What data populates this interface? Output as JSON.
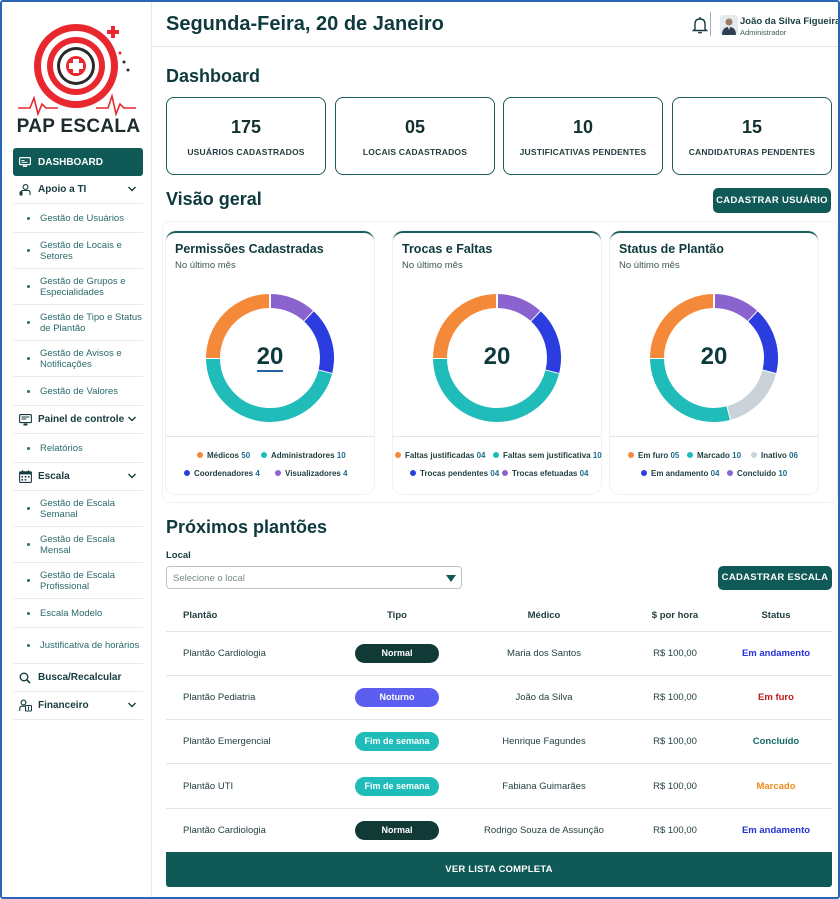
{
  "app": {
    "logo_text": "PAP ESCALA"
  },
  "header": {
    "date": "Segunda-Feira, 20 de Janeiro",
    "user_name": "João da Silva Figueira",
    "user_role": "Administrador"
  },
  "sidebar": {
    "items": [
      {
        "label": "DASHBOARD",
        "icon": "monitor-icon",
        "active": true
      },
      {
        "label": "Apoio a TI",
        "icon": "support-icon",
        "expandable": true,
        "children": [
          "Gestão de Usuários",
          "Gestão de Locais e Setores",
          "Gestão de Grupos e Especialidades",
          "Gestão de Tipo e Status de Plantão",
          "Gestão de Avisos e Notificações",
          "Gestão de Valores"
        ]
      },
      {
        "label": "Painel de controle",
        "icon": "control-panel-icon",
        "expandable": true,
        "children": [
          "Relatórios"
        ]
      },
      {
        "label": "Escala",
        "icon": "calendar-icon",
        "expandable": true,
        "children": [
          "Gestão de Escala Semanal",
          "Gestão de Escala Mensal",
          "Gestão de Escala Profissional",
          "Escala Modelo",
          "Justificativa de horários"
        ]
      },
      {
        "label": "Busca/Recalcular",
        "icon": "search-icon",
        "expandable": false
      },
      {
        "label": "Financeiro",
        "icon": "finance-icon",
        "expandable": true
      }
    ]
  },
  "dashboard": {
    "title": "Dashboard",
    "stats": [
      {
        "value": "175",
        "label": "USUÁRIOS CADASTRADOS"
      },
      {
        "value": "05",
        "label": "LOCAIS CADASTRADOS"
      },
      {
        "value": "10",
        "label": "JUSTIFICATIVAS PENDENTES"
      },
      {
        "value": "15",
        "label": "CANDIDATURAS PENDENTES"
      }
    ]
  },
  "overview": {
    "title": "Visão geral",
    "button": "CADASTRAR USUÁRIO",
    "cards": [
      {
        "title": "Permissões Cadastradas",
        "subtitle": "No último mês",
        "total": "20",
        "segments": [
          {
            "label": "Médicos",
            "value": 50,
            "color": "#f5893a"
          },
          {
            "label": "Administradores",
            "value": 10,
            "color": "#1fbcb9"
          },
          {
            "label": "Coordenadores",
            "value": 4,
            "color": "#2c3de0"
          },
          {
            "label": "Visualizadores",
            "value": 4,
            "color": "#8a63cf"
          }
        ],
        "donut_order": [
          "Visualizadores",
          "Coordenadores",
          "Administradores",
          "Médicos"
        ],
        "donut_fractions": [
          0.12,
          0.17,
          0.46,
          0.25
        ]
      },
      {
        "title": "Trocas e Faltas",
        "subtitle": "No último mês",
        "total": "20",
        "segments": [
          {
            "label": "Faltas justificadas",
            "value": "04",
            "color": "#f5893a"
          },
          {
            "label": "Faltas sem justificativa",
            "value": 10,
            "color": "#1fbcb9"
          },
          {
            "label": "Trocas pendentes",
            "value": "04",
            "color": "#2c3de0"
          },
          {
            "label": "Trocas efetuadas",
            "value": "04",
            "color": "#8a63cf"
          }
        ],
        "donut_order": [
          "Trocas efetuadas",
          "Trocas pendentes",
          "Faltas sem justificativa",
          "Faltas justificadas"
        ],
        "donut_fractions": [
          0.12,
          0.17,
          0.46,
          0.25
        ]
      },
      {
        "title": "Status de Plantão",
        "subtitle": "No último mês",
        "total": "20",
        "segments": [
          {
            "label": "Em furo",
            "value": "05",
            "color": "#f5893a"
          },
          {
            "label": "Marcado",
            "value": 10,
            "color": "#1fbcb9"
          },
          {
            "label": "Inativo",
            "value": "06",
            "color": "#c9d3d9"
          },
          {
            "label": "Em andamento",
            "value": "04",
            "color": "#2c3de0"
          },
          {
            "label": "Concluído",
            "value": 10,
            "color": "#8a63cf"
          }
        ],
        "donut_order": [
          "Concluído",
          "Em andamento",
          "Inativo",
          "Marcado",
          "Em furo"
        ],
        "donut_fractions": [
          0.12,
          0.17,
          0.17,
          0.29,
          0.25
        ]
      }
    ]
  },
  "shifts": {
    "title": "Próximos plantões",
    "local_label": "Local",
    "local_placeholder": "Selecione o local",
    "button": "CADASTRAR ESCALA",
    "columns": [
      "Plantão",
      "Tipo",
      "Médico",
      "$ por hora",
      "Status"
    ],
    "rows": [
      {
        "plantao": "Plantão Cardiologia",
        "tipo": "Normal",
        "medico": "Maria dos Santos",
        "valor": "R$ 100,00",
        "status": "Em andamento"
      },
      {
        "plantao": "Plantão Pediatria",
        "tipo": "Noturno",
        "medico": "João da Silva",
        "valor": "R$ 100,00",
        "status": "Em furo"
      },
      {
        "plantao": "Plantão Emergencial",
        "tipo": "Fim de semana",
        "medico": "Henrique Fagundes",
        "valor": "R$ 100,00",
        "status": "Concluído"
      },
      {
        "plantao": "Plantão UTI",
        "tipo": "Fim de semana",
        "medico": "Fabiana Guimarães",
        "valor": "R$ 100,00",
        "status": "Marcado"
      },
      {
        "plantao": "Plantão Cardiologia",
        "tipo": "Normal",
        "medico": "Rodrigo Souza de Assunção",
        "valor": "R$ 100,00",
        "status": "Em andamento"
      }
    ],
    "tipo_colors": {
      "Normal": "#113a37",
      "Noturno": "#5b5ef0",
      "Fim de semana": "#1fbcb9"
    },
    "status_colors": {
      "Em andamento": "#2430d8",
      "Em furo": "#c21a1a",
      "Concluído": "#156a64",
      "Marcado": "#f08a1c"
    },
    "view_all": "VER LISTA COMPLETA"
  }
}
